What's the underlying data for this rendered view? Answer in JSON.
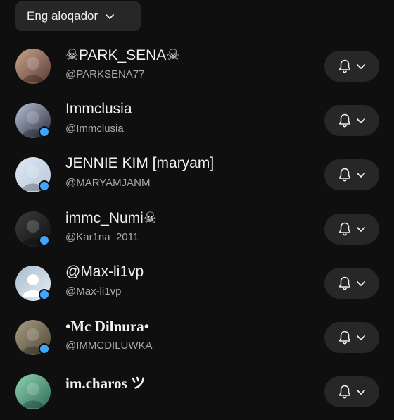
{
  "sort": {
    "label": "Eng aloqador",
    "icon": "chevron-down-icon"
  },
  "channels": [
    {
      "name": "☠PARK_SENA☠",
      "handle": "@PARKSENA77",
      "verified_dot": false,
      "serif": false,
      "avatar_colors": [
        "#c8a590",
        "#5a3b34"
      ]
    },
    {
      "name": "Immclusia",
      "handle": "@Immclusia",
      "verified_dot": true,
      "serif": false,
      "avatar_colors": [
        "#b9c2d8",
        "#2a2d3a"
      ]
    },
    {
      "name": "JENNIE KIM [maryam]",
      "handle": "@MARYAMJANM",
      "verified_dot": true,
      "serif": false,
      "avatar_colors": [
        "#dfe8f2",
        "#b8c7d8"
      ]
    },
    {
      "name": "immc_Numi☠",
      "handle": "@Kar1na_2011",
      "verified_dot": true,
      "serif": false,
      "avatar_colors": [
        "#3b3b3b",
        "#121212"
      ]
    },
    {
      "name": " @Max-li1vp",
      "handle": "@Max-li1vp",
      "verified_dot": true,
      "serif": false,
      "avatar_colors": [
        "#a9bccd",
        "#e6eef5"
      ]
    },
    {
      "name": "•Mc Dilnura•",
      "handle": "@IMMCDILUWKA",
      "verified_dot": true,
      "serif": true,
      "avatar_colors": [
        "#a89d84",
        "#4e4636"
      ]
    },
    {
      "name": "im.charos ツ",
      "handle": "",
      "verified_dot": false,
      "serif": true,
      "avatar_colors": [
        "#8fd3b5",
        "#2f6c55"
      ]
    }
  ],
  "icons": {
    "bell": "bell-icon",
    "chevron": "chevron-down-icon"
  },
  "colors": {
    "background": "#0f0f0f",
    "chip": "#272727",
    "accent": "#3ea6ff",
    "secondary_text": "#aaaaaa"
  }
}
